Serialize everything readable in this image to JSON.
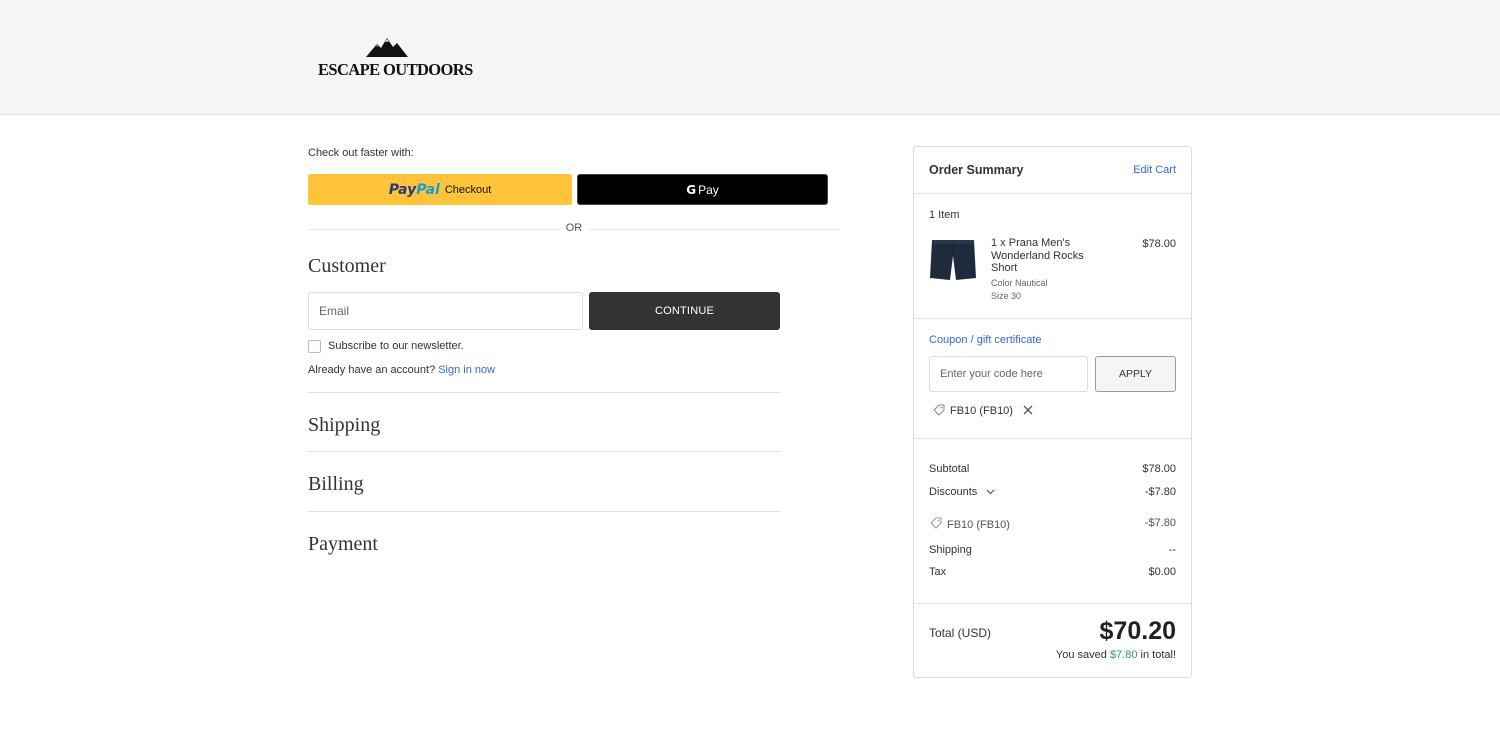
{
  "header": {
    "logo_text": "ESCAPE OUTDOORS"
  },
  "express": {
    "label": "Check out faster with:",
    "paypal_brand_a": "Pay",
    "paypal_brand_b": "Pal",
    "paypal_label": "Checkout",
    "gpay_g": "G",
    "gpay_label": "Pay",
    "or_label": "OR"
  },
  "customer": {
    "title": "Customer",
    "email_placeholder": "Email",
    "continue_label": "CONTINUE",
    "newsletter_label": "Subscribe to our newsletter.",
    "account_prompt": "Already have an account?",
    "signin_label": "Sign in now"
  },
  "steps": {
    "shipping": "Shipping",
    "billing": "Billing",
    "payment": "Payment"
  },
  "summary": {
    "title": "Order Summary",
    "edit_cart": "Edit Cart",
    "items_count": "1 Item",
    "product": {
      "name": "1 x Prana Men's Wonderland Rocks Short",
      "color": "Color Nautical",
      "size": "Size 30",
      "price": "$78.00"
    },
    "coupon_link": "Coupon / gift certificate",
    "coupon_placeholder": "Enter your code here",
    "apply_label": "APPLY",
    "applied_coupon": "FB10 (FB10)",
    "subtotal_label": "Subtotal",
    "subtotal_value": "$78.00",
    "discounts_label": "Discounts",
    "discounts_value": "-$7.80",
    "discount_code": "FB10 (FB10)",
    "discount_code_value": "-$7.80",
    "shipping_label": "Shipping",
    "shipping_value": "--",
    "tax_label": "Tax",
    "tax_value": "$0.00",
    "total_label": "Total (USD)",
    "total_value": "$70.20",
    "saved_prefix": "You saved",
    "saved_amount": "$7.80",
    "saved_suffix": "in total!"
  },
  "colors": {
    "paypal_yellow": "#ffc439",
    "link_blue": "#3367d6",
    "savings_green": "#2e9e4f",
    "dark_button": "#333333"
  }
}
